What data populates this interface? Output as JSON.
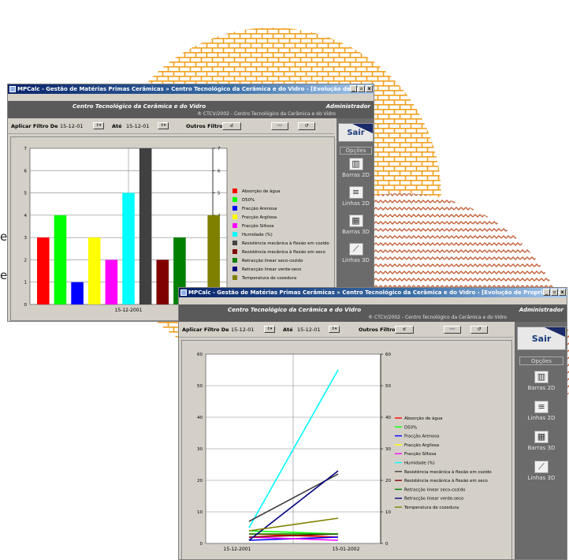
{
  "decor": {
    "partial_text_1": "eriais",
    "partial_text_2": "esa"
  },
  "window_bar": {
    "title": "MPCalc - Gestão de Matérias Primas Cerâmicas  » Centro Tecnológico da Cerâmica e do Vidro - [Evolução de Propriedades]",
    "banner_title": "Centro Tecnológico da Cerâmica e do Vidro",
    "copyright": "® CTCV/2002 - Centro Tecnológico da Cerâmica e do Vidro",
    "user": "Administrador",
    "filter_label": "Aplicar Filtro De",
    "from_date": "15-12-01",
    "to_label": "Até",
    "to_date": "15-12-01",
    "other_filters": "Outros Filtros",
    "sair": "Sair",
    "opcoes": "Opções",
    "options": [
      "Barras 2D",
      "Linhas 2D",
      "Barras 3D",
      "Linhas 3D"
    ]
  },
  "window_line": {
    "title": "MPCalc - Gestão de Matérias Primas Cerâmicas  » Centro Tecnológico da Cerâmica e do Vidro - [Evolução de Propriedades]",
    "banner_title": "Centro Tecnológico da Cerâmica e do Vidro",
    "copyright": "® CTCV/2002 - Centro Tecnológico da Cerâmica e do Vidro",
    "user": "Administrador",
    "filter_label": "Aplicar Filtro De",
    "from_date": "15-12-01",
    "to_label": "Até",
    "to_date": "15-12-01",
    "other_filters": "Outros Filtros",
    "sair": "Sair",
    "opcoes": "Opções",
    "options": [
      "Barras 2D",
      "Linhas 2D",
      "Barras 3D",
      "Linhas 3D"
    ]
  },
  "chart_data": [
    {
      "type": "bar",
      "categories": [
        "15-12-2001"
      ],
      "ylim": [
        0,
        7
      ],
      "yticks": [
        0,
        1,
        2,
        3,
        4,
        5,
        6,
        7
      ],
      "grid": true,
      "legend_position": "right",
      "series": [
        {
          "name": "Absorção de água",
          "color": "#ff0000",
          "values": [
            3
          ]
        },
        {
          "name": "D50%",
          "color": "#00ff00",
          "values": [
            4
          ]
        },
        {
          "name": "Fracção Arenosa",
          "color": "#0000ff",
          "values": [
            1
          ]
        },
        {
          "name": "Fracção Argilosa",
          "color": "#ffff00",
          "values": [
            3
          ]
        },
        {
          "name": "Fracção Siltosa",
          "color": "#ff00ff",
          "values": [
            2
          ]
        },
        {
          "name": "Humidade (%)",
          "color": "#00ffff",
          "values": [
            5
          ]
        },
        {
          "name": "Resistência mecânica à flexão em cozido",
          "color": "#404040",
          "values": [
            7
          ]
        },
        {
          "name": "Resistência mecânica à flexão em seco",
          "color": "#800000",
          "values": [
            2
          ]
        },
        {
          "name": "Retracção linear seco-cozido",
          "color": "#008000",
          "values": [
            3
          ]
        },
        {
          "name": "Retracção linear verde-seco",
          "color": "#000080",
          "values": [
            0
          ]
        },
        {
          "name": "Temperatura de cozedura",
          "color": "#808000",
          "values": [
            4
          ]
        }
      ]
    },
    {
      "type": "line",
      "categories": [
        "15-12-2001",
        "15-01-2002"
      ],
      "ylim": [
        0,
        60
      ],
      "yticks": [
        0,
        10,
        20,
        30,
        40,
        50,
        60
      ],
      "grid": true,
      "legend_position": "right",
      "series": [
        {
          "name": "Absorção de água",
          "color": "#ff0000",
          "values": [
            3,
            2
          ]
        },
        {
          "name": "D50%",
          "color": "#00ff00",
          "values": [
            4,
            3
          ]
        },
        {
          "name": "Fracção Arenosa",
          "color": "#0000ff",
          "values": [
            1,
            2
          ]
        },
        {
          "name": "Fracção Argilosa",
          "color": "#ffff00",
          "values": [
            3,
            3
          ]
        },
        {
          "name": "Fracção Siltosa",
          "color": "#ff00ff",
          "values": [
            2,
            1
          ]
        },
        {
          "name": "Humidade (%)",
          "color": "#00ffff",
          "values": [
            5,
            55
          ]
        },
        {
          "name": "Resistência mecânica à flexão em cozido",
          "color": "#404040",
          "values": [
            7,
            22
          ]
        },
        {
          "name": "Resistência mecânica à flexão em seco",
          "color": "#800000",
          "values": [
            2,
            3
          ]
        },
        {
          "name": "Retracção linear seco-cozido",
          "color": "#008000",
          "values": [
            3,
            3
          ]
        },
        {
          "name": "Retracção linear verde-seco",
          "color": "#000080",
          "values": [
            1,
            23
          ]
        },
        {
          "name": "Temperatura de cozedura",
          "color": "#808000",
          "values": [
            4,
            8
          ]
        }
      ]
    }
  ]
}
